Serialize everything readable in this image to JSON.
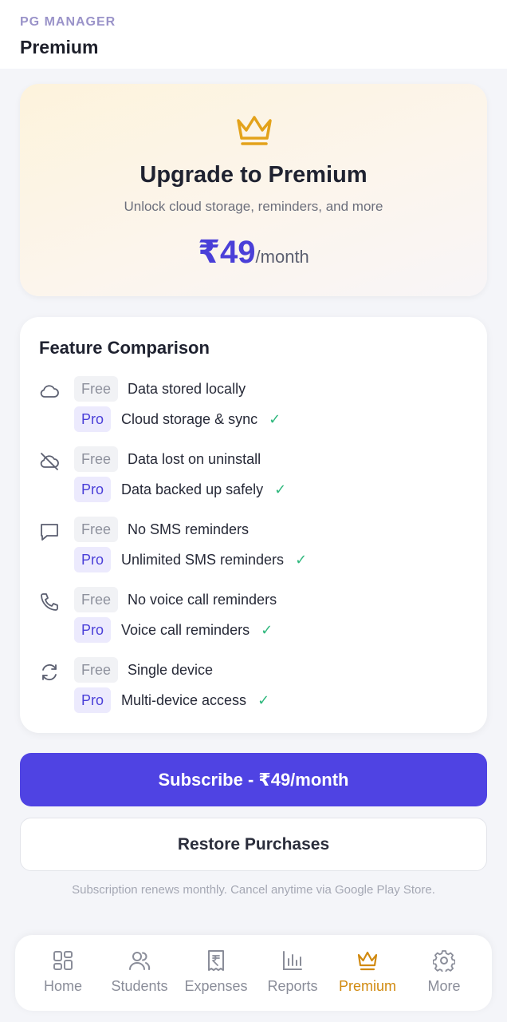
{
  "header": {
    "app_name": "PG MANAGER",
    "title": "Premium"
  },
  "hero": {
    "title": "Upgrade to Premium",
    "subtitle": "Unlock cloud storage, reminders, and more",
    "price": "₹49",
    "price_unit": "/month",
    "icon": "crown-icon"
  },
  "comparison": {
    "title": "Feature Comparison",
    "free_tag": "Free",
    "pro_tag": "Pro",
    "features": [
      {
        "icon": "cloud-icon",
        "free": "Data stored locally",
        "pro": "Cloud storage & sync"
      },
      {
        "icon": "cloud-off-icon",
        "free": "Data lost on uninstall",
        "pro": "Data backed up safely"
      },
      {
        "icon": "message-icon",
        "free": "No SMS reminders",
        "pro": "Unlimited SMS reminders"
      },
      {
        "icon": "phone-icon",
        "free": "No voice call reminders",
        "pro": "Voice call reminders"
      },
      {
        "icon": "sync-icon",
        "free": "Single device",
        "pro": "Multi-device access"
      }
    ]
  },
  "actions": {
    "subscribe_label": "Subscribe - ₹49/month",
    "restore_label": "Restore Purchases",
    "footnote": "Subscription renews monthly. Cancel anytime via Google Play Store."
  },
  "nav": {
    "items": [
      {
        "label": "Home",
        "icon": "grid-icon"
      },
      {
        "label": "Students",
        "icon": "users-icon"
      },
      {
        "label": "Expenses",
        "icon": "receipt-icon"
      },
      {
        "label": "Reports",
        "icon": "bar-chart-icon"
      },
      {
        "label": "Premium",
        "icon": "crown-icon"
      },
      {
        "label": "More",
        "icon": "gear-icon"
      }
    ],
    "active": "Premium"
  },
  "colors": {
    "accent": "#4f43e3",
    "premium": "#e3a21a",
    "check": "#2fb87d"
  }
}
